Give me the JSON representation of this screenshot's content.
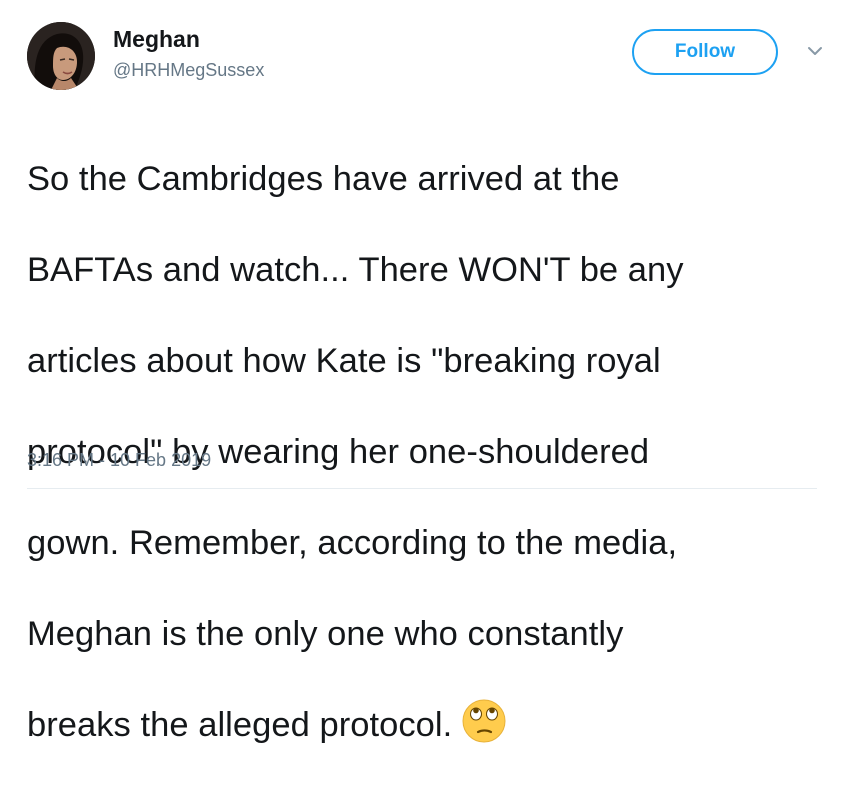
{
  "user": {
    "display_name": "Meghan",
    "handle": "@HRHMegSussex"
  },
  "actions": {
    "follow_label": "Follow"
  },
  "tweet": {
    "lines": [
      "So the Cambridges have arrived at the",
      "BAFTAs and watch... There WON'T be any",
      "articles about how Kate is \"breaking royal",
      "protocol\" by wearing her one-shouldered",
      "gown. Remember, according to the media,",
      "Meghan is the only one who constantly",
      "breaks the alleged protocol."
    ],
    "emoji": "face-with-rolling-eyes",
    "timestamp": "3:16 PM - 10 Feb 2019"
  },
  "colors": {
    "accent": "#1da1f2",
    "text": "#14171a",
    "muted": "#657786",
    "divider": "#e6ecf0"
  },
  "icons": {
    "menu": "chevron-down-icon",
    "avatar": "avatar"
  }
}
